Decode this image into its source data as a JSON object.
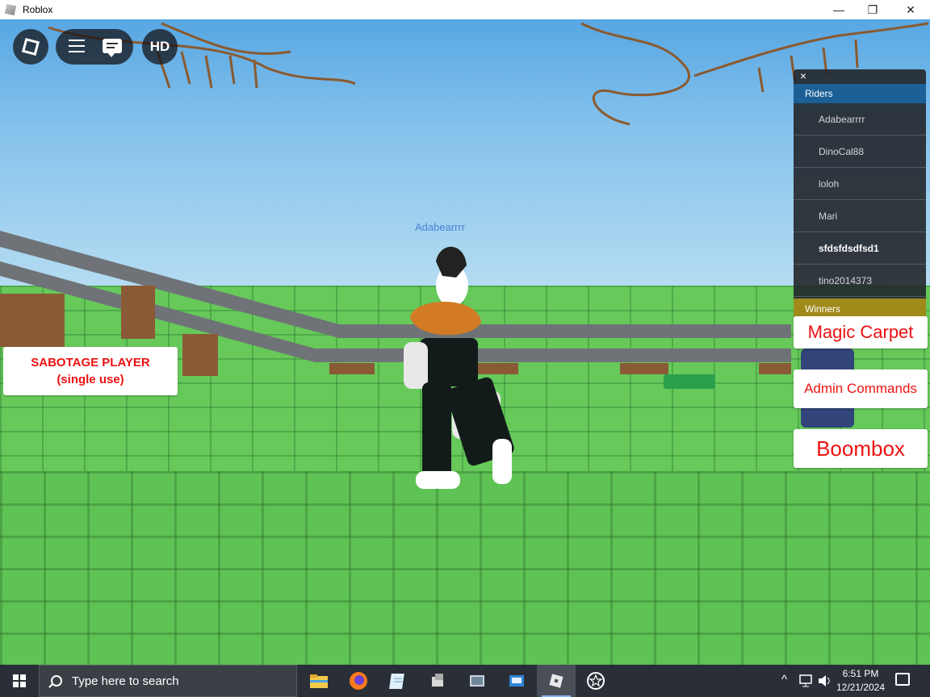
{
  "window": {
    "title": "Roblox",
    "minimize": "—",
    "restore": "❐",
    "close": "✕"
  },
  "hud": {
    "hd_label": "HD"
  },
  "nametag": "Adabearrrr",
  "leaderboard": {
    "close": "×",
    "header": "Riders",
    "players": [
      "Adabearrrr",
      "DinoCal88",
      "loloh",
      "Mari",
      "sfdsfdsdfsd1",
      "tino2014373"
    ],
    "highlighted_player": "sfdsfdsdfsd1",
    "footer": "Winners"
  },
  "actions": {
    "sabotage_line1": "SABOTAGE PLAYER",
    "sabotage_line2": "(single use)",
    "magic_carpet": "Magic Carpet",
    "admin_commands": "Admin Commands",
    "boombox": "Boombox",
    "text_color": "#ee1111"
  },
  "taskbar": {
    "search_placeholder": "Type here to search",
    "apps": [
      "file-explorer-icon",
      "firefox-icon",
      "notepad-icon",
      "app-icon",
      "app-icon",
      "app-icon",
      "roblox-icon",
      "roblox-studio-icon"
    ],
    "tray": {
      "chevron": "^",
      "time": "6:51 PM",
      "date": "12/21/2024"
    }
  },
  "colors": {
    "sky": "#57a7e3",
    "grass": "#66c95a",
    "leaderboard_header": "#1c5f96",
    "leaderboard_footer": "#a08a1a",
    "taskbar": "#2a2f37"
  }
}
